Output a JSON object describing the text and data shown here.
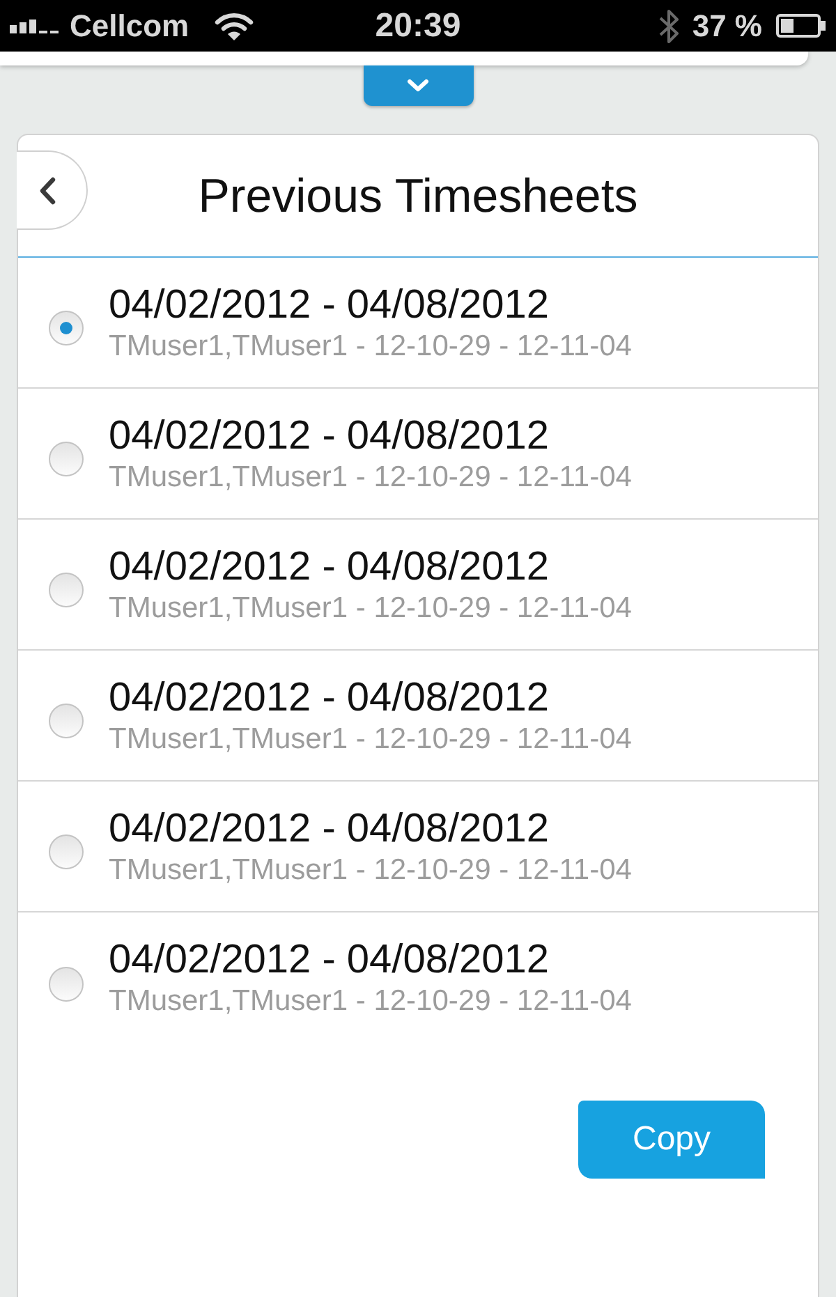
{
  "status_bar": {
    "carrier": "Cellcom",
    "time": "20:39",
    "battery": "37 %"
  },
  "header": {
    "title": "Previous Timesheets"
  },
  "timesheets": [
    {
      "title": "04/02/2012 - 04/08/2012",
      "subtitle": "TMuser1,TMuser1 - 12-10-29 - 12-11-04",
      "selected": true
    },
    {
      "title": "04/02/2012 - 04/08/2012",
      "subtitle": "TMuser1,TMuser1 - 12-10-29 - 12-11-04",
      "selected": false
    },
    {
      "title": "04/02/2012 - 04/08/2012",
      "subtitle": "TMuser1,TMuser1 - 12-10-29 - 12-11-04",
      "selected": false
    },
    {
      "title": "04/02/2012 - 04/08/2012",
      "subtitle": "TMuser1,TMuser1 - 12-10-29 - 12-11-04",
      "selected": false
    },
    {
      "title": "04/02/2012 - 04/08/2012",
      "subtitle": "TMuser1,TMuser1 - 12-10-29 - 12-11-04",
      "selected": false
    },
    {
      "title": "04/02/2012 - 04/08/2012",
      "subtitle": "TMuser1,TMuser1 - 12-10-29 - 12-11-04",
      "selected": false
    }
  ],
  "copy_button": {
    "label": "Copy"
  }
}
